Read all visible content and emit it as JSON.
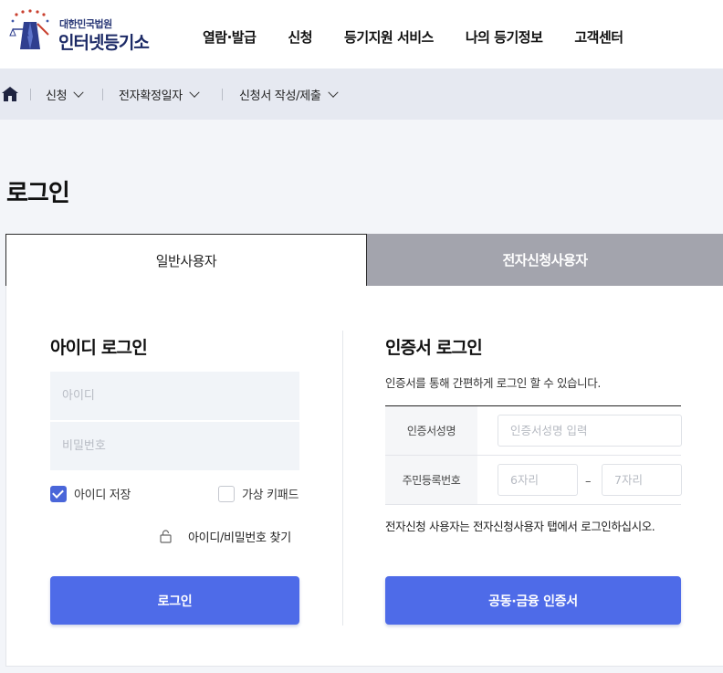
{
  "header": {
    "logo": {
      "small": "대한민국법원",
      "big": "인터넷등기소"
    },
    "nav": [
      "열람·발급",
      "신청",
      "등기지원 서비스",
      "나의 등기정보",
      "고객센터"
    ]
  },
  "breadcrumb": {
    "items": [
      "신청",
      "전자확정일자",
      "신청서 작성/제출"
    ]
  },
  "page_title": "로그인",
  "tabs": {
    "general": "일반사용자",
    "electronic": "전자신청사용자"
  },
  "id_login": {
    "title": "아이디 로그인",
    "id_placeholder": "아이디",
    "pw_placeholder": "비밀번호",
    "save_id_label": "아이디 저장",
    "save_id_checked": true,
    "virtual_keypad_label": "가상 키패드",
    "virtual_keypad_checked": false,
    "find_link": "아이디/비밀번호 찾기",
    "login_button": "로그인"
  },
  "cert_login": {
    "title": "인증서 로그인",
    "description": "인증서를 통해 간편하게 로그인 할 수 있습니다.",
    "cert_name_label": "인증서성명",
    "cert_name_placeholder": "인증서성명 입력",
    "rrn_label": "주민등록번호",
    "rrn_front_placeholder": "6자리",
    "rrn_dash": "–",
    "rrn_back_placeholder": "7자리",
    "note": "전자신청 사용자는 전자신청사용자 탭에서 로그인하십시오.",
    "cert_button": "공동·금융 인증서"
  },
  "colors": {
    "primary": "#4e6be8",
    "checkbox": "#4a66d9",
    "inactive_tab": "#a3a4ad",
    "crumb_bg": "#e6e9f1"
  }
}
